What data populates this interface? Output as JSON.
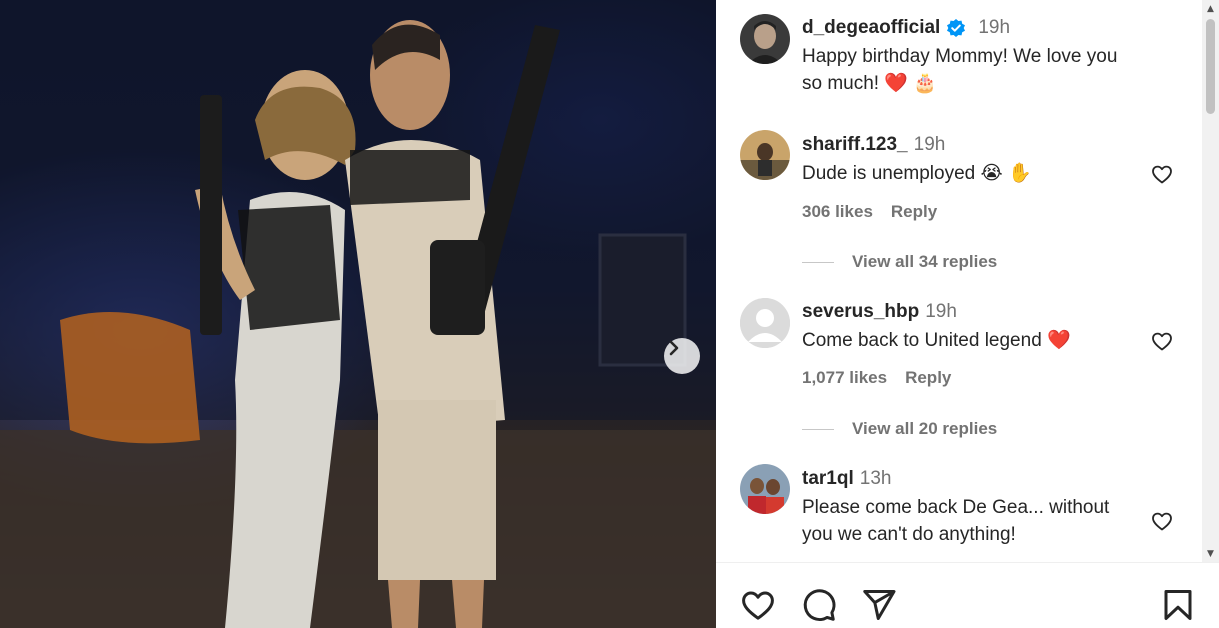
{
  "post": {
    "author": "d_degeaofficial",
    "verified": true,
    "time": "19h",
    "caption": "Happy birthday Mommy! We love you so much! ❤️ 🎂",
    "caption_line1": "Happy birthday Mommy! We love you",
    "caption_line2": "so much! ❤️ 🎂"
  },
  "comments": [
    {
      "username": "shariff.123_",
      "time": "19h",
      "text": "Dude is unemployed 😭 ✋",
      "likes": "306 likes",
      "reply_label": "Reply",
      "view_replies": "View all 34 replies"
    },
    {
      "username": "severus_hbp",
      "time": "19h",
      "text": "Come back to United legend ❤️",
      "likes": "1,077 likes",
      "reply_label": "Reply",
      "view_replies": "View all 20 replies"
    },
    {
      "username": "tar1ql",
      "time": "13h",
      "text_line1": "Please come back De Gea... without",
      "text_line2": "you we can't do anything!"
    }
  ],
  "icons": {
    "verified": "verified-badge-icon",
    "next": "chevron-right-icon",
    "like": "heart-icon",
    "comment": "comment-icon",
    "share": "send-icon",
    "save": "bookmark-icon"
  },
  "colors": {
    "verified": "#0095f6",
    "heart": "#ff3040",
    "muted": "#737373",
    "text": "#262626"
  }
}
